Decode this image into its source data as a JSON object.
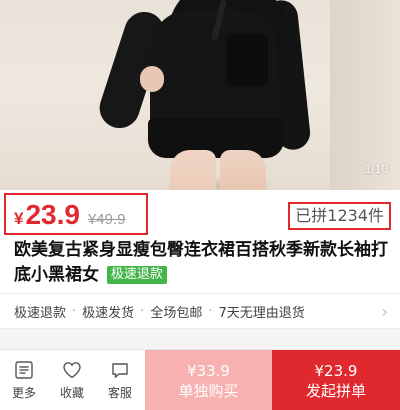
{
  "gallery": {
    "counter": "1/10"
  },
  "price": {
    "currency": "¥",
    "current": "23.9",
    "original": "¥49.9"
  },
  "sold": "已拼1234件",
  "product": {
    "title": "欧美复古紧身显瘦包臀连衣裙百搭秋季新款长袖打底小黑裙女",
    "badge": "极速退款"
  },
  "services": [
    "极速退款",
    "极速发货",
    "全场包邮",
    "7天无理由退货"
  ],
  "toolbar": {
    "more": "更多",
    "favorite": "收藏",
    "service": "客服"
  },
  "buy_solo": {
    "price": "¥33.9",
    "label": "单独购买"
  },
  "buy_group": {
    "price": "¥23.9",
    "label": "发起拼单"
  },
  "colors": {
    "accent": "#e0292f",
    "solo": "#f7b1b0",
    "badge": "#44b549"
  }
}
